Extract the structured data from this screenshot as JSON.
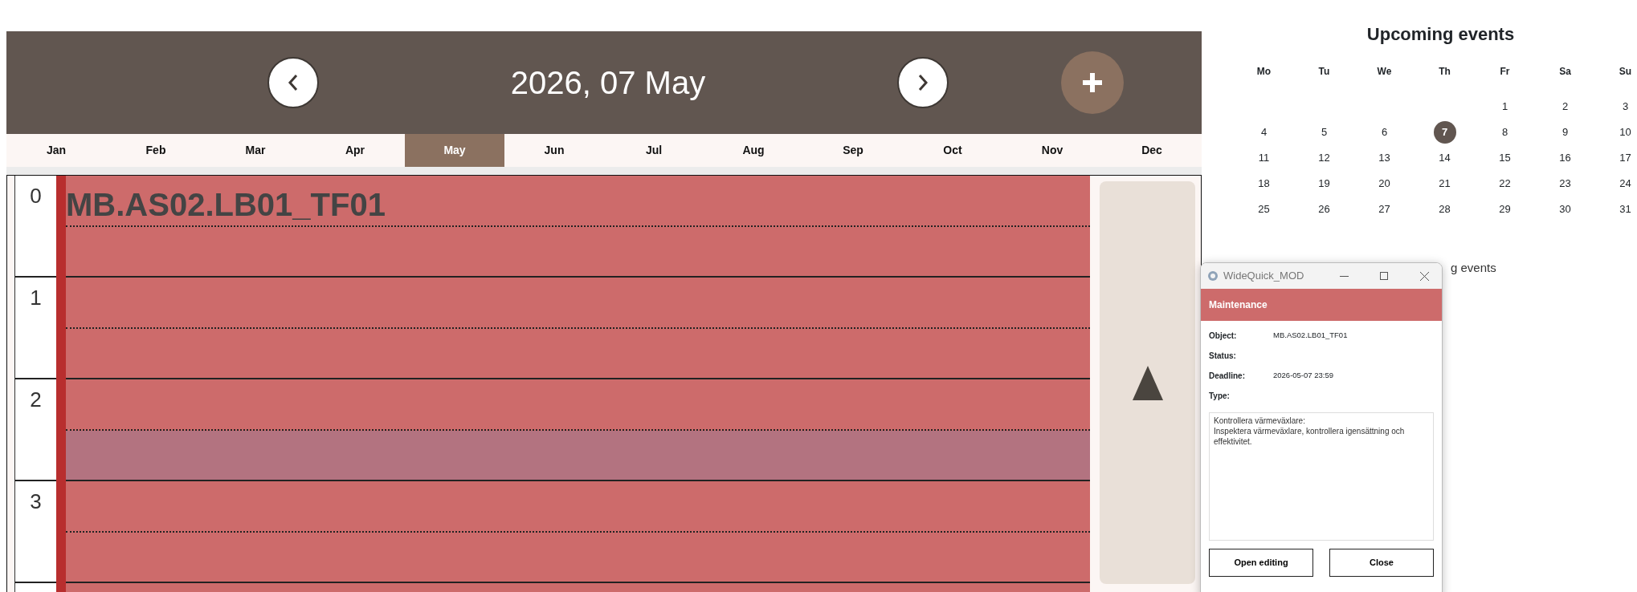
{
  "header": {
    "title": "2026, 07 May"
  },
  "months": [
    {
      "label": "Jan",
      "selected": false
    },
    {
      "label": "Feb",
      "selected": false
    },
    {
      "label": "Mar",
      "selected": false
    },
    {
      "label": "Apr",
      "selected": false
    },
    {
      "label": "May",
      "selected": true
    },
    {
      "label": "Jun",
      "selected": false
    },
    {
      "label": "Jul",
      "selected": false
    },
    {
      "label": "Aug",
      "selected": false
    },
    {
      "label": "Sep",
      "selected": false
    },
    {
      "label": "Oct",
      "selected": false
    },
    {
      "label": "Nov",
      "selected": false
    },
    {
      "label": "Dec",
      "selected": false
    }
  ],
  "schedule": {
    "hours": [
      {
        "label": "0",
        "second_half_highlighted": false
      },
      {
        "label": "1",
        "second_half_highlighted": false
      },
      {
        "label": "2",
        "second_half_highlighted": true
      },
      {
        "label": "3",
        "second_half_highlighted": false
      }
    ],
    "event": {
      "title": "MB.AS02.LB01_TF01"
    }
  },
  "sidebar": {
    "title": "Upcoming events",
    "weekdays": [
      "Mo",
      "Tu",
      "We",
      "Th",
      "Fr",
      "Sa",
      "Su"
    ],
    "weeks": [
      [
        {
          "label": "1",
          "selected": false
        },
        {
          "label": "2",
          "selected": false
        },
        {
          "label": "3",
          "selected": false
        }
      ],
      [
        {
          "label": "4",
          "selected": false
        },
        {
          "label": "5",
          "selected": false
        },
        {
          "label": "6",
          "selected": false
        },
        {
          "label": "7",
          "selected": true
        },
        {
          "label": "8",
          "selected": false
        },
        {
          "label": "9",
          "selected": false
        },
        {
          "label": "10",
          "selected": false
        }
      ],
      [
        {
          "label": "11",
          "selected": false
        },
        {
          "label": "12",
          "selected": false
        },
        {
          "label": "13",
          "selected": false
        },
        {
          "label": "14",
          "selected": false
        },
        {
          "label": "15",
          "selected": false
        },
        {
          "label": "16",
          "selected": false
        },
        {
          "label": "17",
          "selected": false
        }
      ],
      [
        {
          "label": "18",
          "selected": false
        },
        {
          "label": "19",
          "selected": false
        },
        {
          "label": "20",
          "selected": false
        },
        {
          "label": "21",
          "selected": false
        },
        {
          "label": "22",
          "selected": false
        },
        {
          "label": "23",
          "selected": false
        },
        {
          "label": "24",
          "selected": false
        }
      ],
      [
        {
          "label": "25",
          "selected": false
        },
        {
          "label": "26",
          "selected": false
        },
        {
          "label": "27",
          "selected": false
        },
        {
          "label": "28",
          "selected": false
        },
        {
          "label": "29",
          "selected": false
        },
        {
          "label": "30",
          "selected": false
        },
        {
          "label": "31",
          "selected": false
        }
      ]
    ],
    "events_text": "g events"
  },
  "dialog": {
    "window_title": "WideQuick_MOD",
    "header": "Maintenance",
    "fields": [
      {
        "label": "Object:",
        "value": "MB.AS02.LB01_TF01"
      },
      {
        "label": "Status:"
      },
      {
        "label": "Deadline:",
        "value": "2026-05-07 23:59"
      },
      {
        "label": "Type:"
      }
    ],
    "description": "Kontrollera värmeväxlare:\nInspektera värmeväxlare, kontrollera igensättning och effektivitet.",
    "buttons": [
      "Open editing",
      "Close"
    ]
  }
}
